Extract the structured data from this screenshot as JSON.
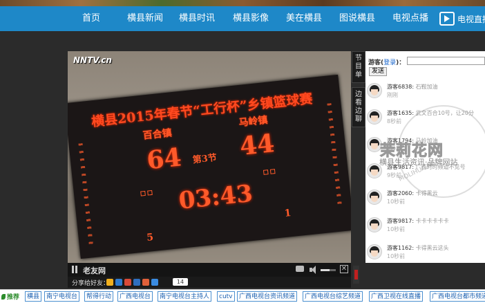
{
  "nav": {
    "items": [
      "首页",
      "横县新闻",
      "横县时讯",
      "横县影像",
      "美在横县",
      "图说横县",
      "电视点播"
    ],
    "tv_live": "电视直播"
  },
  "video": {
    "watermark": "NNTV.cn",
    "scoreboard": {
      "title": "横县2015年春节“工行杯”乡镇篮球赛",
      "home_team": "百合镇",
      "away_team": "马岭镇",
      "home_score": "64",
      "away_score": "44",
      "period": "第3节",
      "clock": "03:43",
      "home_fouls": "5",
      "away_fouls": "1"
    }
  },
  "controls": {
    "title": "老友网",
    "volume_level": 0.6
  },
  "share": {
    "label": "分享给好友：",
    "count": "14",
    "icons": [
      {
        "name": "qzone-icon",
        "color": "#f2b01e"
      },
      {
        "name": "sina-icon",
        "color": "#2e7bcf"
      },
      {
        "name": "tencent-icon",
        "color": "#d94a38"
      },
      {
        "name": "renren-icon",
        "color": "#2f6fbf"
      },
      {
        "name": "kaixin-icon",
        "color": "#e0603a"
      },
      {
        "name": "more-icon",
        "color": "#3a8be0"
      }
    ]
  },
  "side_tabs": [
    "节目单",
    "边看边聊"
  ],
  "chat": {
    "prefix": "游客(",
    "login": "登录",
    "suffix": ")：",
    "send": "发送",
    "messages": [
      {
        "user": "游客6838:",
        "text": " 石鞍加油",
        "time": "刚刚"
      },
      {
        "user": "游客1635:",
        "text": " 武文百合10号，让20分",
        "time": "8秒前"
      },
      {
        "user": "游客1794:",
        "text": " 马岭加油",
        "time": "8秒前"
      },
      {
        "user": "游客9817:",
        "text": " 广西时时频道不见号",
        "time": "9秒前"
      },
      {
        "user": "游客2060:",
        "text": " 卡得黑云",
        "time": "10秒前"
      },
      {
        "user": "游客9817:",
        "text": " 卡卡卡卡卡卡",
        "time": "10秒前"
      },
      {
        "user": "游客1162:",
        "text": " 卡得黑云这头",
        "time": "10秒前"
      }
    ]
  },
  "brand_watermark": {
    "brand": "茉莉花网",
    "subtitle": "横县生活资讯·品牌网站",
    "url": "MOLIHUA.NET"
  },
  "bottom": {
    "recommend": "推荐",
    "links": [
      "横县",
      "南宁电视台",
      "帮得行动",
      "广西电视台",
      "南宁电视台主持人",
      "cutv",
      "广西电视台资讯频道",
      "广西电视台综艺频道",
      "广西卫视在线直播",
      "广西电视台都市频道"
    ]
  }
}
